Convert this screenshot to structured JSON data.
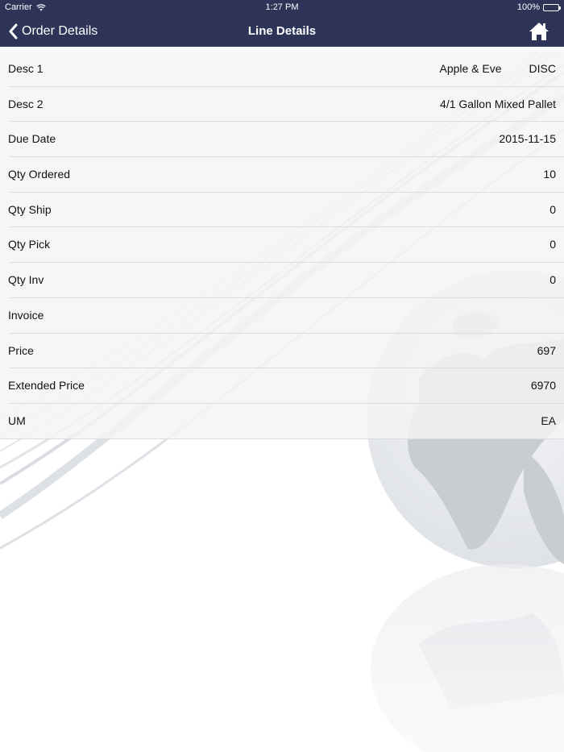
{
  "status_bar": {
    "carrier": "Carrier",
    "time": "1:27 PM",
    "battery": "100%"
  },
  "nav": {
    "back_label": "Order Details",
    "title": "Line Details"
  },
  "rows": [
    {
      "label": "Desc 1",
      "value": "Apple & Eve",
      "value2": "DISC"
    },
    {
      "label": "Desc 2",
      "value": "4/1 Gallon Mixed Pallet"
    },
    {
      "label": "Due Date",
      "value": "2015-11-15"
    },
    {
      "label": "Qty Ordered",
      "value": "10"
    },
    {
      "label": "Qty Ship",
      "value": "0"
    },
    {
      "label": "Qty Pick",
      "value": "0"
    },
    {
      "label": "Qty Inv",
      "value": "0"
    },
    {
      "label": "Invoice",
      "value": ""
    },
    {
      "label": "Price",
      "value": "697"
    },
    {
      "label": "Extended Price",
      "value": "6970"
    },
    {
      "label": "UM",
      "value": "EA"
    }
  ],
  "colors": {
    "nav_background": "#2d3458",
    "row_background": "#f4f4f4",
    "text": "#111111",
    "globe": "#c9ccd1"
  },
  "icons": {
    "back": "chevron-left-icon",
    "home": "home-icon",
    "wifi": "wifi-icon",
    "battery": "battery-icon"
  }
}
